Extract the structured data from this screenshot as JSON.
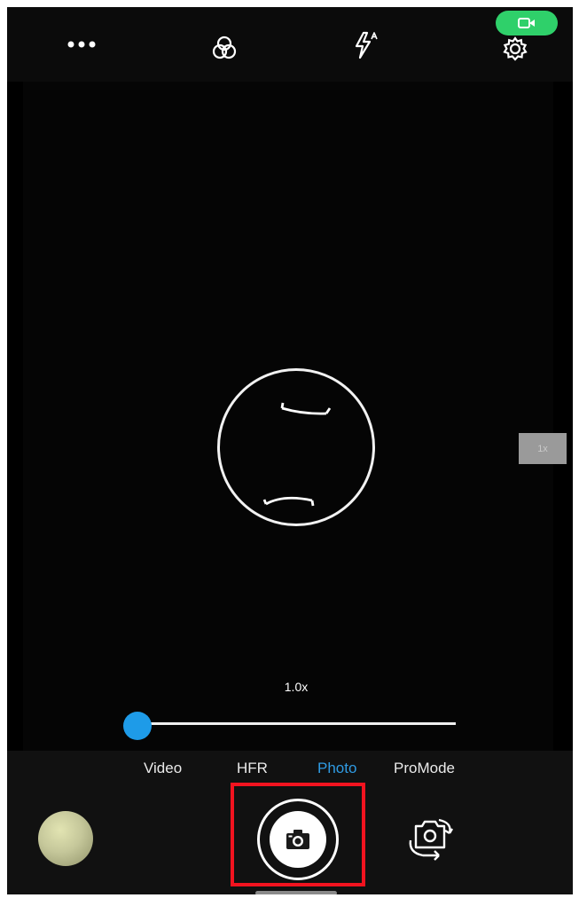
{
  "topbar": {
    "icons": [
      "more-options-icon",
      "filters-icon",
      "flash-auto-icon",
      "settings-gear-icon",
      "video-record-icon"
    ]
  },
  "viewfinder": {
    "zoom_tag": "1x",
    "zoom_readout": "1.0x",
    "zoom_level_fraction": 0.0
  },
  "modes": {
    "items": [
      "Video",
      "HFR",
      "Photo",
      "ProMode"
    ],
    "active": "Photo"
  },
  "controls": {
    "icons": [
      "gallery-thumbnail",
      "camera-shutter-icon",
      "switch-camera-icon"
    ]
  },
  "colors": {
    "accent": "#1e9be8",
    "record_pill": "#2fd06a",
    "highlight": "#f2131f"
  }
}
